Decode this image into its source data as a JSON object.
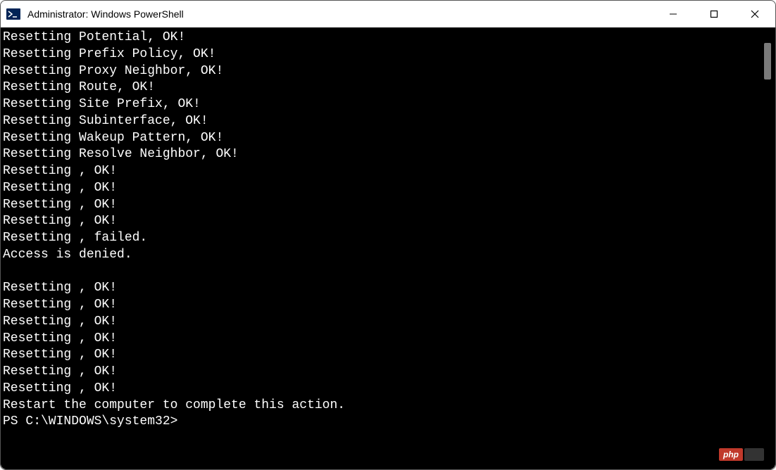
{
  "window": {
    "title": "Administrator: Windows PowerShell"
  },
  "terminal": {
    "lines": [
      "Resetting Potential, OK!",
      "Resetting Prefix Policy, OK!",
      "Resetting Proxy Neighbor, OK!",
      "Resetting Route, OK!",
      "Resetting Site Prefix, OK!",
      "Resetting Subinterface, OK!",
      "Resetting Wakeup Pattern, OK!",
      "Resetting Resolve Neighbor, OK!",
      "Resetting , OK!",
      "Resetting , OK!",
      "Resetting , OK!",
      "Resetting , OK!",
      "Resetting , failed.",
      "Access is denied.",
      "",
      "Resetting , OK!",
      "Resetting , OK!",
      "Resetting , OK!",
      "Resetting , OK!",
      "Resetting , OK!",
      "Resetting , OK!",
      "Resetting , OK!",
      "Restart the computer to complete this action.",
      ""
    ],
    "prompt": "PS C:\\WINDOWS\\system32>"
  },
  "watermark": {
    "text": "php"
  }
}
